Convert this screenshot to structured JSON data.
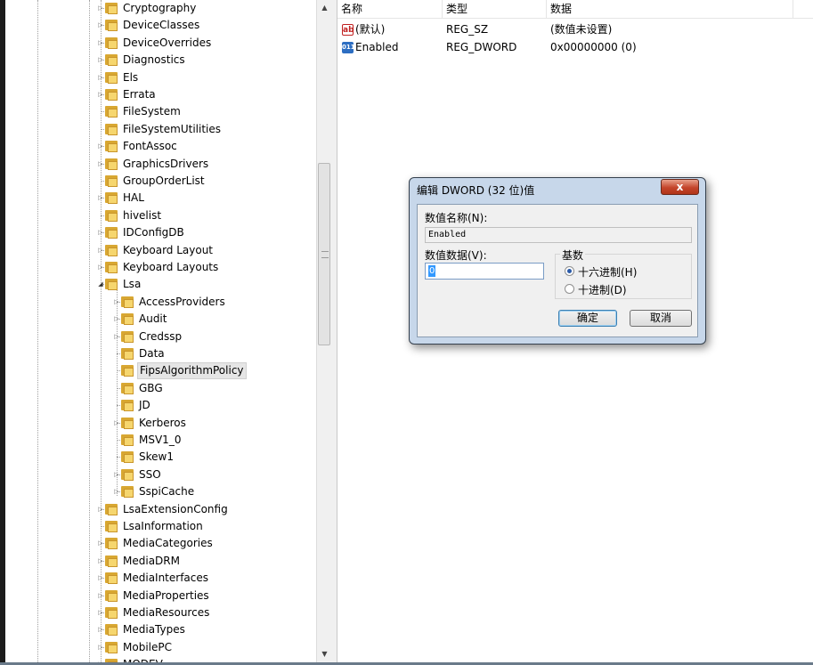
{
  "tree": {
    "items": [
      {
        "label": "Cryptography",
        "level": 0,
        "expander": "collapsed"
      },
      {
        "label": "DeviceClasses",
        "level": 0,
        "expander": "collapsed"
      },
      {
        "label": "DeviceOverrides",
        "level": 0,
        "expander": "collapsed"
      },
      {
        "label": "Diagnostics",
        "level": 0,
        "expander": "collapsed"
      },
      {
        "label": "Els",
        "level": 0,
        "expander": "collapsed"
      },
      {
        "label": "Errata",
        "level": 0,
        "expander": "collapsed"
      },
      {
        "label": "FileSystem",
        "level": 0,
        "expander": "none"
      },
      {
        "label": "FileSystemUtilities",
        "level": 0,
        "expander": "none"
      },
      {
        "label": "FontAssoc",
        "level": 0,
        "expander": "collapsed"
      },
      {
        "label": "GraphicsDrivers",
        "level": 0,
        "expander": "collapsed"
      },
      {
        "label": "GroupOrderList",
        "level": 0,
        "expander": "none"
      },
      {
        "label": "HAL",
        "level": 0,
        "expander": "collapsed"
      },
      {
        "label": "hivelist",
        "level": 0,
        "expander": "none"
      },
      {
        "label": "IDConfigDB",
        "level": 0,
        "expander": "collapsed"
      },
      {
        "label": "Keyboard Layout",
        "level": 0,
        "expander": "collapsed"
      },
      {
        "label": "Keyboard Layouts",
        "level": 0,
        "expander": "collapsed"
      },
      {
        "label": "Lsa",
        "level": 0,
        "expander": "expanded"
      },
      {
        "label": "AccessProviders",
        "level": 1,
        "expander": "collapsed"
      },
      {
        "label": "Audit",
        "level": 1,
        "expander": "collapsed"
      },
      {
        "label": "Credssp",
        "level": 1,
        "expander": "collapsed"
      },
      {
        "label": "Data",
        "level": 1,
        "expander": "none"
      },
      {
        "label": "FipsAlgorithmPolicy",
        "level": 1,
        "expander": "none",
        "selected": true
      },
      {
        "label": "GBG",
        "level": 1,
        "expander": "none"
      },
      {
        "label": "JD",
        "level": 1,
        "expander": "none"
      },
      {
        "label": "Kerberos",
        "level": 1,
        "expander": "collapsed"
      },
      {
        "label": "MSV1_0",
        "level": 1,
        "expander": "none"
      },
      {
        "label": "Skew1",
        "level": 1,
        "expander": "none"
      },
      {
        "label": "SSO",
        "level": 1,
        "expander": "collapsed"
      },
      {
        "label": "SspiCache",
        "level": 1,
        "expander": "collapsed"
      },
      {
        "label": "LsaExtensionConfig",
        "level": 0,
        "expander": "collapsed"
      },
      {
        "label": "LsaInformation",
        "level": 0,
        "expander": "none"
      },
      {
        "label": "MediaCategories",
        "level": 0,
        "expander": "collapsed"
      },
      {
        "label": "MediaDRM",
        "level": 0,
        "expander": "collapsed"
      },
      {
        "label": "MediaInterfaces",
        "level": 0,
        "expander": "collapsed"
      },
      {
        "label": "MediaProperties",
        "level": 0,
        "expander": "collapsed"
      },
      {
        "label": "MediaResources",
        "level": 0,
        "expander": "collapsed"
      },
      {
        "label": "MediaTypes",
        "level": 0,
        "expander": "collapsed"
      },
      {
        "label": "MobilePC",
        "level": 0,
        "expander": "collapsed"
      },
      {
        "label": "MODEV",
        "level": 0,
        "expander": "collapsed"
      }
    ]
  },
  "list": {
    "columns": [
      "名称",
      "类型",
      "数据"
    ],
    "rows": [
      {
        "icon": "string-value-icon",
        "name": "(默认)",
        "type": "REG_SZ",
        "data": "(数值未设置)"
      },
      {
        "icon": "dword-value-icon",
        "name": "Enabled",
        "type": "REG_DWORD",
        "data": "0x00000000 (0)"
      }
    ]
  },
  "dialog": {
    "title": "编辑 DWORD (32 位)值",
    "close_label": "x",
    "name_label": "数值名称(N):",
    "name_value": "Enabled",
    "data_label": "数值数据(V):",
    "data_value": "0",
    "base_label": "基数",
    "base_options": [
      {
        "label": "十六进制(H)",
        "selected": true
      },
      {
        "label": "十进制(D)",
        "selected": false
      }
    ],
    "ok_label": "确定",
    "cancel_label": "取消"
  },
  "colors": {
    "dialog_frame": "#c7d7ea",
    "close_button": "#c4452b",
    "selection": "#3399ff",
    "folder": "#f6d66e"
  }
}
